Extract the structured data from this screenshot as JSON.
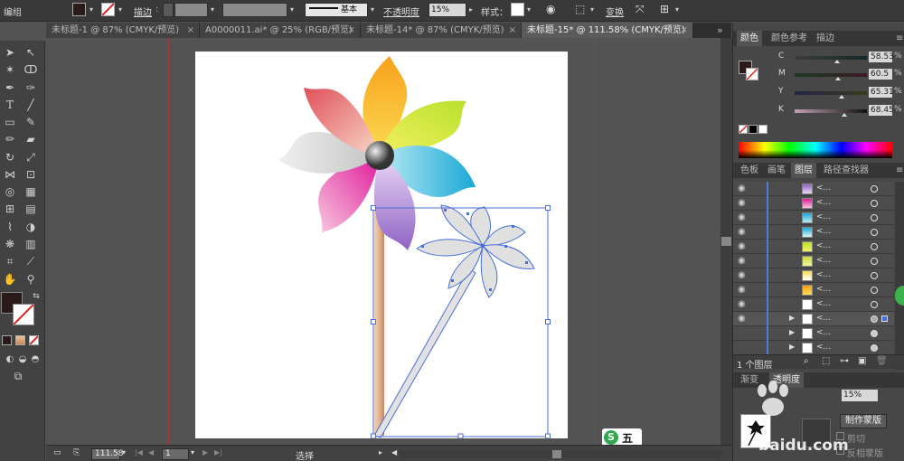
{
  "control_bar": {
    "mode_label": "编组",
    "stroke_label": "描边",
    "stroke_style": "基本",
    "opacity_label": "不透明度",
    "opacity_value": "15%",
    "style_label": "样式：",
    "transform_label": "变换"
  },
  "tabs": [
    {
      "label": "未标题-1 @ 87% (CMYK/预览)",
      "close": "×"
    },
    {
      "label": "A0000011.ai* @ 25% (RGB/预览)",
      "close": "×"
    },
    {
      "label": "未标题-14* @ 87% (CMYK/预览)",
      "close": "×"
    },
    {
      "label": "未标题-15* @ 111.58% (CMYK/预览)",
      "close": "×"
    }
  ],
  "color_panel": {
    "tabs": [
      "颜色",
      "颜色参考",
      "描边"
    ],
    "channels": [
      {
        "name": "C",
        "value": "58.53",
        "unit": "%",
        "level": 0.585
      },
      {
        "name": "M",
        "value": "60.5",
        "unit": "%",
        "level": 0.605
      },
      {
        "name": "Y",
        "value": "65.31",
        "unit": "%",
        "level": 0.653
      },
      {
        "name": "K",
        "value": "68.45",
        "unit": "%",
        "level": 0.685
      }
    ]
  },
  "layers_panel": {
    "tabs": [
      "色板",
      "画笔",
      "图层",
      "路径查找器"
    ],
    "rows": [
      {
        "name": "<..."
      },
      {
        "name": "<..."
      },
      {
        "name": "<..."
      },
      {
        "name": "<..."
      },
      {
        "name": "<..."
      },
      {
        "name": "<..."
      },
      {
        "name": "<..."
      },
      {
        "name": "<..."
      },
      {
        "name": "<..."
      },
      {
        "name": "<..."
      },
      {
        "name": "<..."
      },
      {
        "name": "<..."
      }
    ],
    "footer_label": "1 个图层"
  },
  "bottom_panel": {
    "tabs": [
      "渐变",
      "透明度"
    ],
    "opacity_value": "15%",
    "mask_button": "制作蒙版",
    "clip_label": "剪切",
    "invert_label": "反相蒙版"
  },
  "status_bar": {
    "zoom": "111.58",
    "artboard_num": "1",
    "tool_label": "选择"
  },
  "watermark": {
    "site": "baidu.com",
    "brand": "五"
  },
  "colors": {
    "guide": "#a53a3a",
    "selection": "#4a6fd6",
    "active_tab_bg": "#5b5b5b"
  }
}
